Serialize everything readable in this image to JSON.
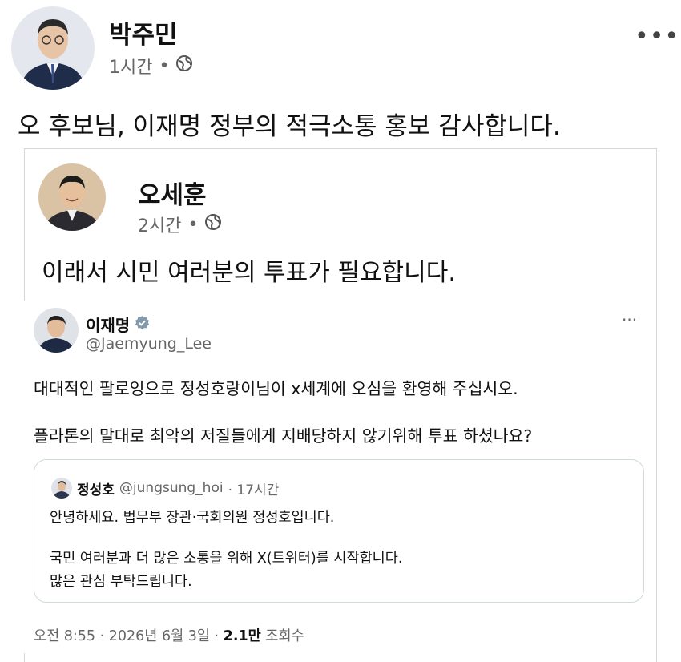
{
  "post": {
    "author": "박주민",
    "time": "1시간",
    "separator": "•",
    "more_label": "•••",
    "text": "오 후보님, 이재명 정부의 적극소통 홍보 감사합니다."
  },
  "shared_post": {
    "author": "오세훈",
    "time": "2시간",
    "separator": "•",
    "text": "이래서 시민 여러분의 투표가 필요합니다."
  },
  "tweet": {
    "name": "이재명",
    "handle": "@Jaemyung_Lee",
    "more_label": "···",
    "line1": "대대적인 팔로잉으로 정성호랑이님이 x세계에 오심을 환영해 주십시오.",
    "line2": "플라톤의 말대로 최악의 저질들에게 지배당하지 않기위해 투표 하셨나요?",
    "footer_time": "오전 8:55 · 2026년 6월 3일 · ",
    "footer_views_count": "2.1만",
    "footer_views_label": " 조회수"
  },
  "quoted_tweet": {
    "name": "정성호",
    "handle": "@jungsung_hoi",
    "time": "· 17시간",
    "line1": "안녕하세요. 법무부 장관·국회의원 정성호입니다.",
    "line2": "국민 여러분과 더 많은 소통을 위해 X(트위터)를 시작합니다.",
    "line3": "많은 관심 부탁드립니다."
  },
  "icons": {
    "privacy": "globe-icon",
    "verified": "verified-badge-icon"
  },
  "colors": {
    "verified_badge": "#829aab",
    "meta_text": "#666666",
    "card_border": "#d6d6d6",
    "quote_border": "#cfd9de"
  }
}
